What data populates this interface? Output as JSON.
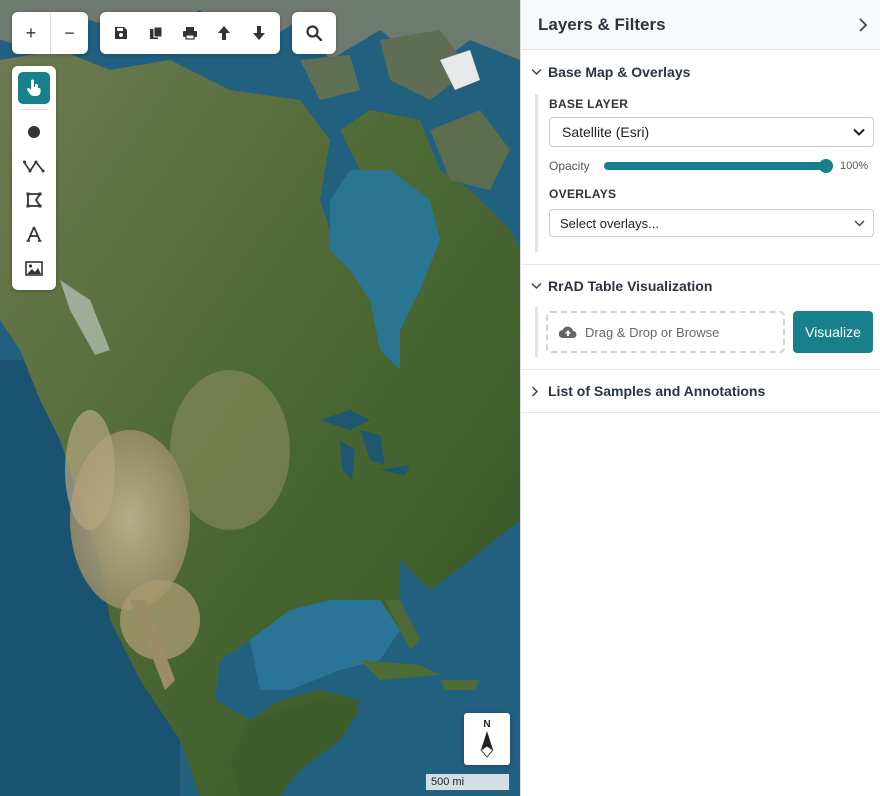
{
  "map": {
    "zoom_in_label": "+",
    "zoom_out_label": "−",
    "file_tools": [
      {
        "icon": "save-icon"
      },
      {
        "icon": "copy-icon"
      },
      {
        "icon": "print-icon"
      },
      {
        "icon": "arrow-up-icon"
      },
      {
        "icon": "arrow-down-icon"
      }
    ],
    "draw_tools": [
      {
        "icon": "pointer-hand-icon",
        "active": true
      },
      {
        "icon": "point-icon"
      },
      {
        "icon": "polyline-icon"
      },
      {
        "icon": "polygon-icon"
      },
      {
        "icon": "text-icon"
      },
      {
        "icon": "image-icon"
      }
    ],
    "north_label": "N",
    "scale_label": "500 mi",
    "accent_color": "#17808a"
  },
  "panel": {
    "title": "Layers & Filters",
    "sections": [
      {
        "label": "Base Map & Overlays",
        "expanded": true,
        "base_layer_label": "BASE LAYER",
        "base_layer_value": "Satellite (Esri)",
        "opacity_label": "Opacity",
        "opacity_value": "100%",
        "opacity_fraction": 1.0,
        "overlays_label": "OVERLAYS",
        "overlays_placeholder": "Select overlays..."
      },
      {
        "label": "RrAD Table Visualization",
        "expanded": true,
        "dropzone_text": "Drag & Drop or Browse",
        "visualize_label": "Visualize"
      },
      {
        "label": "List of Samples and Annotations",
        "expanded": false
      }
    ]
  }
}
